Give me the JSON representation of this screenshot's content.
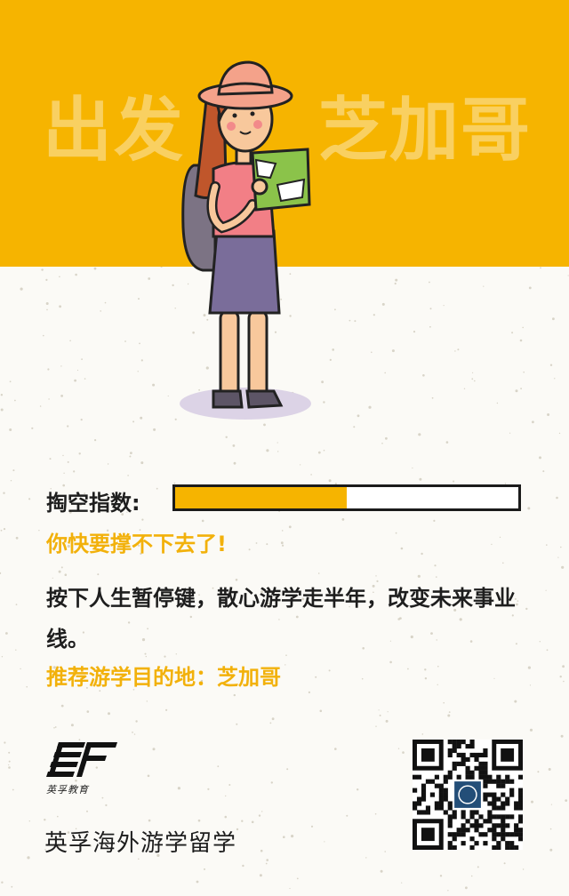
{
  "poster": {
    "title_left": "出发",
    "title_right": "芝加哥"
  },
  "meter": {
    "label": "掏空指数:",
    "level_fraction": 0.5,
    "fill_color": "#f6b400"
  },
  "warning": "你快要撑不下去了!",
  "message": "按下人生暂停键，散心游学走半年，改变未来事业线。",
  "recommendation": "推荐游学目的地：芝加哥",
  "brand": {
    "logo_icon": "ef-logo-icon",
    "logo_caption": "英孚教育",
    "name": "英孚海外游学留学"
  },
  "colors": {
    "accent": "#f6b400",
    "text": "#1e1e1e"
  }
}
